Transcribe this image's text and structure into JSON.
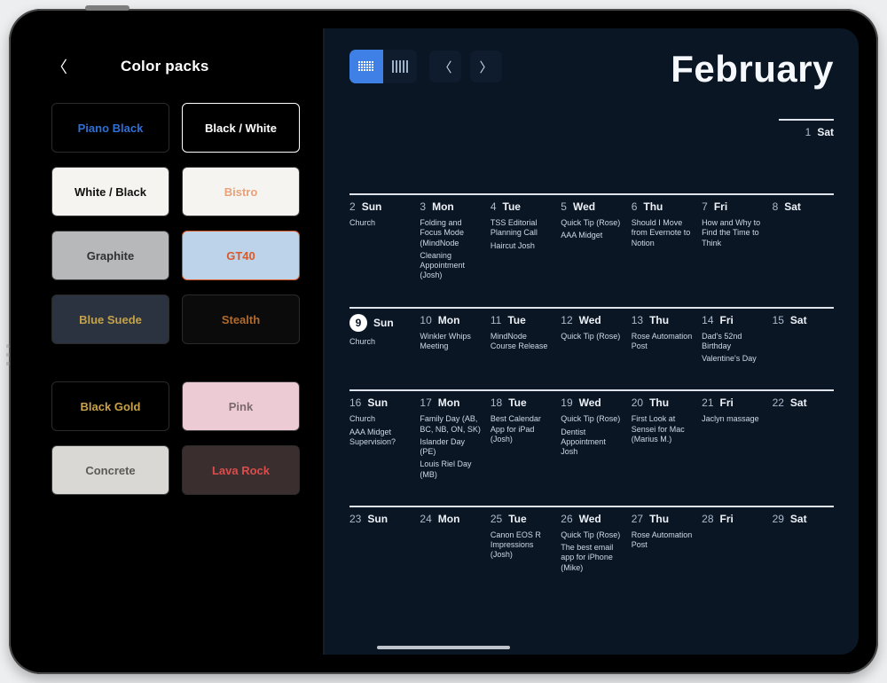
{
  "sidebar": {
    "title": "Color packs",
    "packs": [
      {
        "name": "Piano Black",
        "bg": "#000000",
        "text": "#2e6fd6",
        "border": "#2a2a2a"
      },
      {
        "name": "Black / White",
        "bg": "#000000",
        "text": "#ffffff",
        "border": "#ffffff"
      },
      {
        "name": "White / Black",
        "bg": "#f5f4f0",
        "text": "#111111",
        "border": "#3a3a3a"
      },
      {
        "name": "Bistro",
        "bg": "#f5f4f0",
        "text": "#e7a27a",
        "border": "#3a3a3a"
      },
      {
        "name": "Graphite",
        "bg": "#b7b8ba",
        "text": "#303134",
        "border": "#3a3a3a"
      },
      {
        "name": "GT40",
        "bg": "#bcd3ea",
        "text": "#d75a2a",
        "border": "#d75a2a"
      },
      {
        "name": "Blue Suede",
        "bg": "#2c3340",
        "text": "#c4a24a",
        "border": "#2a2a2a"
      },
      {
        "name": "Stealth",
        "bg": "#0b0b0b",
        "text": "#b06a2d",
        "border": "#2a2a2a"
      }
    ],
    "packs2": [
      {
        "name": "Black Gold",
        "bg": "#000000",
        "text": "#c9a24a",
        "border": "#2a2a2a"
      },
      {
        "name": "Pink",
        "bg": "#eccbd4",
        "text": "#7a6a6f",
        "border": "#3a3a3a"
      },
      {
        "name": "Concrete",
        "bg": "#d9d8d4",
        "text": "#5a5a58",
        "border": "#3a3a3a"
      },
      {
        "name": "Lava Rock",
        "bg": "#3a2e2e",
        "text": "#d94d4d",
        "border": "#2a2a2a"
      }
    ]
  },
  "calendar": {
    "month": "February",
    "weeks": [
      [
        {
          "num": "1",
          "name": "Sat",
          "events": []
        }
      ],
      [
        {
          "num": "2",
          "name": "Sun",
          "events": [
            "Church"
          ]
        },
        {
          "num": "3",
          "name": "Mon",
          "events": [
            "Folding and Focus Mode (MindNode",
            "Cleaning Appointment (Josh)"
          ]
        },
        {
          "num": "4",
          "name": "Tue",
          "events": [
            "TSS Editorial Planning Call",
            "Haircut Josh"
          ]
        },
        {
          "num": "5",
          "name": "Wed",
          "events": [
            "Quick Tip (Rose)",
            "AAA Midget"
          ]
        },
        {
          "num": "6",
          "name": "Thu",
          "events": [
            "Should I Move from Evernote to Notion"
          ]
        },
        {
          "num": "7",
          "name": "Fri",
          "events": [
            "How and Why to Find the Time to Think"
          ]
        },
        {
          "num": "8",
          "name": "Sat",
          "events": []
        }
      ],
      [
        {
          "num": "9",
          "name": "Sun",
          "today": true,
          "events": [
            "Church"
          ]
        },
        {
          "num": "10",
          "name": "Mon",
          "events": [
            "Winkler Whips Meeting"
          ]
        },
        {
          "num": "11",
          "name": "Tue",
          "events": [
            "MindNode Course Release"
          ]
        },
        {
          "num": "12",
          "name": "Wed",
          "events": [
            "Quick Tip (Rose)"
          ]
        },
        {
          "num": "13",
          "name": "Thu",
          "events": [
            "Rose Automation Post"
          ]
        },
        {
          "num": "14",
          "name": "Fri",
          "events": [
            "Dad's 52nd Birthday",
            "Valentine's Day"
          ]
        },
        {
          "num": "15",
          "name": "Sat",
          "events": []
        }
      ],
      [
        {
          "num": "16",
          "name": "Sun",
          "events": [
            "Church",
            "AAA Midget Supervision?"
          ]
        },
        {
          "num": "17",
          "name": "Mon",
          "events": [
            "Family Day (AB, BC, NB, ON, SK)",
            "Islander Day (PE)",
            "Louis Riel Day (MB)"
          ]
        },
        {
          "num": "18",
          "name": "Tue",
          "events": [
            "Best Calendar App for iPad (Josh)"
          ]
        },
        {
          "num": "19",
          "name": "Wed",
          "events": [
            "Quick Tip (Rose)",
            "Dentist Appointment Josh"
          ]
        },
        {
          "num": "20",
          "name": "Thu",
          "events": [
            "First Look at Sensei for Mac (Marius M.)"
          ]
        },
        {
          "num": "21",
          "name": "Fri",
          "events": [
            "Jaclyn massage"
          ]
        },
        {
          "num": "22",
          "name": "Sat",
          "events": []
        }
      ],
      [
        {
          "num": "23",
          "name": "Sun",
          "events": []
        },
        {
          "num": "24",
          "name": "Mon",
          "events": []
        },
        {
          "num": "25",
          "name": "Tue",
          "events": [
            "Canon EOS R Impressions (Josh)"
          ]
        },
        {
          "num": "26",
          "name": "Wed",
          "events": [
            "Quick Tip (Rose)",
            "The best email app for iPhone (Mike)"
          ]
        },
        {
          "num": "27",
          "name": "Thu",
          "events": [
            "Rose Automation Post"
          ]
        },
        {
          "num": "28",
          "name": "Fri",
          "events": []
        },
        {
          "num": "29",
          "name": "Sat",
          "events": []
        }
      ]
    ]
  }
}
